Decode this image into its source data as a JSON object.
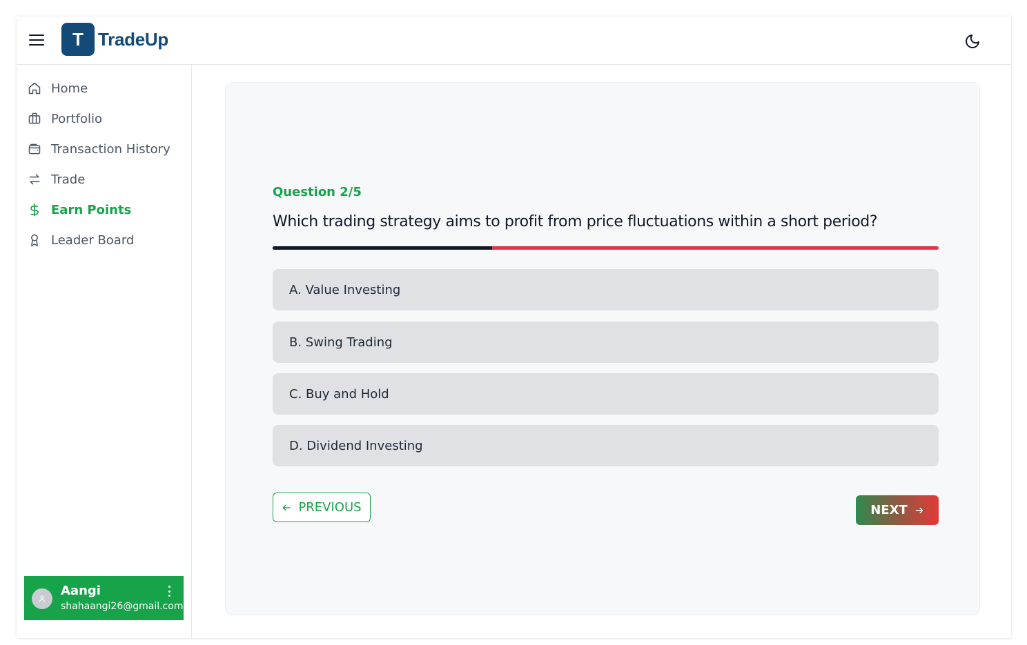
{
  "app": {
    "logo_letter": "T",
    "name": "TradeUp"
  },
  "sidebar": {
    "items": [
      {
        "label": "Home",
        "icon": "home-icon"
      },
      {
        "label": "Portfolio",
        "icon": "briefcase-icon"
      },
      {
        "label": "Transaction History",
        "icon": "wallet-icon"
      },
      {
        "label": "Trade",
        "icon": "arrows-swap-icon"
      },
      {
        "label": "Earn Points",
        "icon": "dollar-icon",
        "active": true
      },
      {
        "label": "Leader Board",
        "icon": "award-icon"
      }
    ]
  },
  "user": {
    "name": "Aangi",
    "email": "shahaangi26@gmail.com"
  },
  "quiz": {
    "counter": "Question 2/5",
    "progress": 0.33,
    "question": "Which trading strategy aims to profit from price fluctuations within a short period?",
    "options": [
      "A. Value Investing",
      "B. Swing Trading",
      "C. Buy and Hold",
      "D. Dividend Investing"
    ],
    "prev_label": "PREVIOUS",
    "next_label": "NEXT"
  },
  "colors": {
    "brand": "#134a78",
    "accent": "#16a34a",
    "progress_remaining": "#dc3545",
    "progress_done": "#111827"
  }
}
